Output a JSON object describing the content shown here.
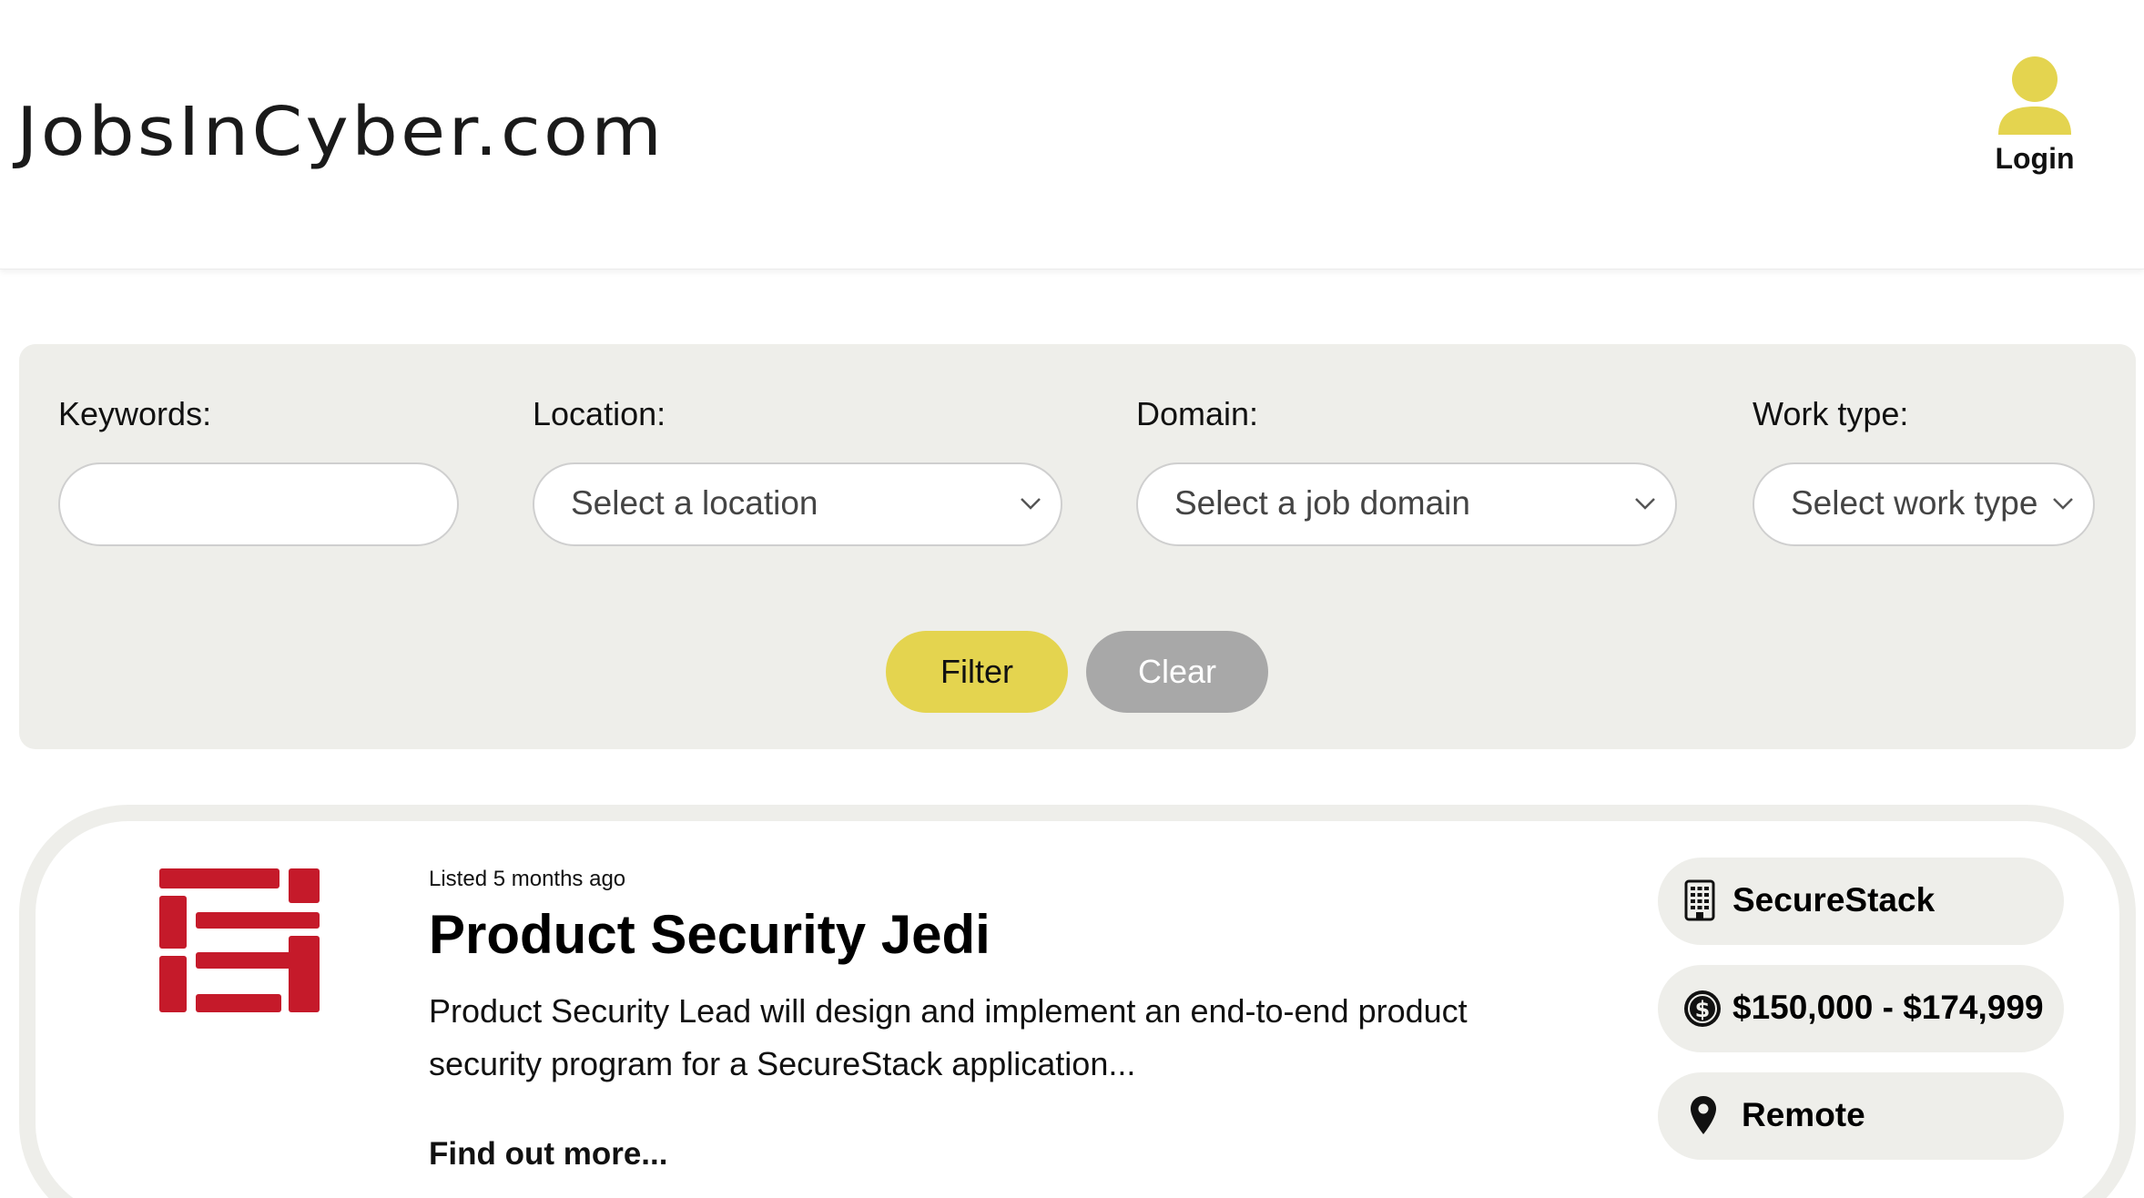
{
  "header": {
    "logo_text": "JobsInCyber.com",
    "login_label": "Login",
    "accent_color": "#e4d44f"
  },
  "filters": {
    "keywords": {
      "label": "Keywords:",
      "value": ""
    },
    "location": {
      "label": "Location:",
      "placeholder": "Select a location"
    },
    "domain": {
      "label": "Domain:",
      "placeholder": "Select a job domain"
    },
    "work_type": {
      "label": "Work type:",
      "placeholder": "Select work type"
    },
    "filter_button": "Filter",
    "clear_button": "Clear"
  },
  "job": {
    "listed": "Listed 5 months ago",
    "title": "Product Security Jedi",
    "description": "Product Security Lead will design and implement an end-to-end product security program for a SecureStack application...",
    "find_more": "Find out more...",
    "company": "SecureStack",
    "salary": "$150,000 - $174,999",
    "location": "Remote",
    "logo_color": "#c51a2a",
    "icons": {
      "company": "building-icon",
      "salary": "dollar-coin-icon",
      "location": "map-pin-icon"
    }
  }
}
